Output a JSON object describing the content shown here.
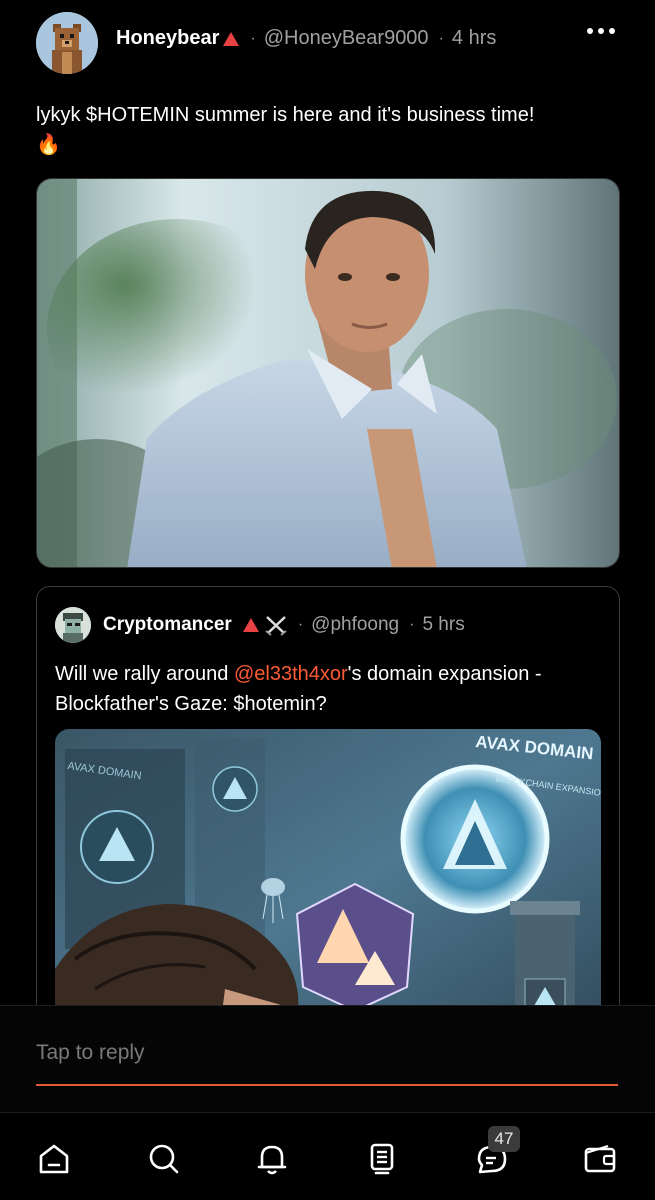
{
  "post": {
    "author_name": "Honeybear",
    "handle": "@HoneyBear9000",
    "time": "4 hrs",
    "text": "lykyk $HOTEMIN summer is here and it's business time!",
    "emoji": "🔥",
    "more_icon": "more-horizontal-icon"
  },
  "quote": {
    "author_name": "Cryptomancer",
    "handle": "@phfoong",
    "time": "5 hrs",
    "text_before": "Will we rally around ",
    "mention": "@el33th4xor",
    "text_after": "'s domain expansion - Blockfather's Gaze: $hotemin?",
    "image_labels": {
      "top_left": "AVAX DOMAIN",
      "top_right": "AVAX DOMAIN",
      "sub_right": "BLOCKCHAIN EXPANSION"
    }
  },
  "reply": {
    "placeholder": "Tap to reply"
  },
  "nav": {
    "items": [
      "home-icon",
      "search-icon",
      "notifications-icon",
      "feed-icon",
      "chat-icon",
      "wallet-icon"
    ],
    "chat_badge": "47"
  },
  "colors": {
    "accent": "#ff5a36",
    "background": "#000000",
    "verified_triangle": "#e84142"
  }
}
